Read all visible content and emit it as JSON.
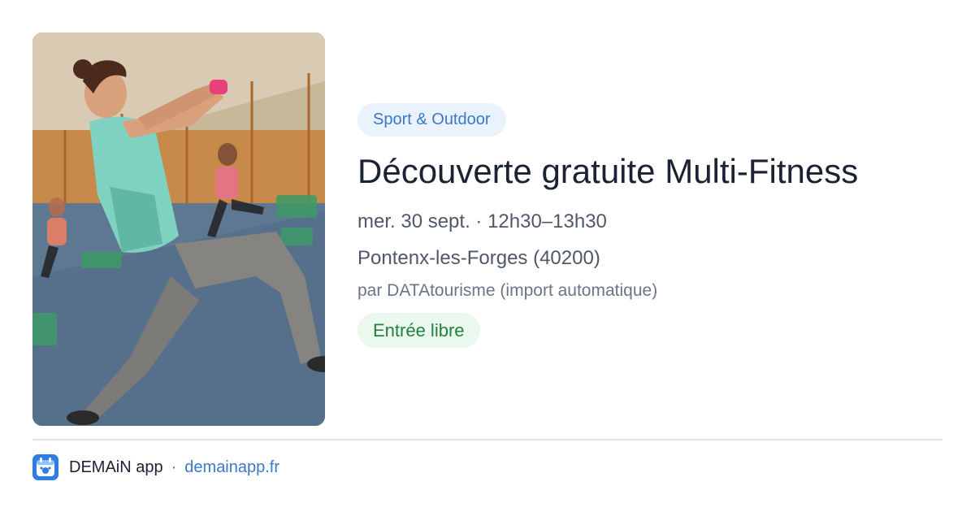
{
  "event": {
    "category": "Sport & Outdoor",
    "title": "Découverte gratuite Multi-Fitness",
    "datetime": "mer. 30 sept. · 12h30–13h30",
    "location": "Pontenx-les-Forges (40200)",
    "organizer": "par DATAtourisme (import automatique)",
    "price": "Entrée libre",
    "photo_icon": "fitness-class-photo"
  },
  "footer": {
    "app_name": "DEMAiN app",
    "separator": "·",
    "domain": "demainapp.fr",
    "logo_icon": "demain-app-logo-icon"
  },
  "colors": {
    "category_bg": "#eaf2fd",
    "category_text": "#3b78c9",
    "price_bg": "#eaf8ee",
    "price_text": "#23823f",
    "title_text": "#1b2333",
    "link": "#3b78c9"
  }
}
